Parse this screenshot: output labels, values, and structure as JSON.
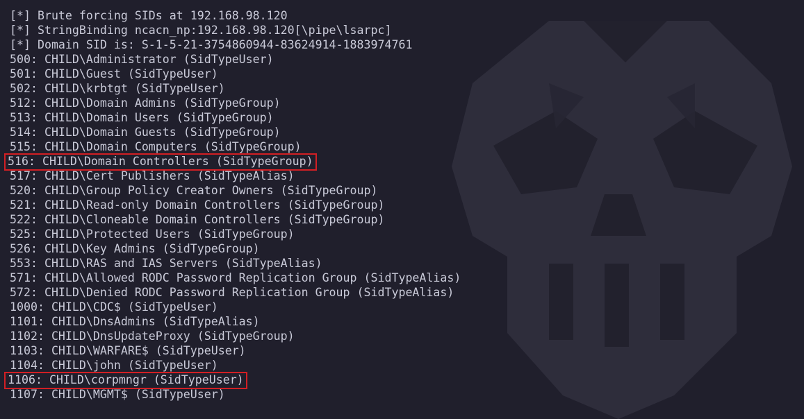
{
  "terminal": {
    "lines": [
      {
        "text": "[*] Brute forcing SIDs at 192.168.98.120",
        "highlighted": false
      },
      {
        "text": "[*] StringBinding ncacn_np:192.168.98.120[\\pipe\\lsarpc]",
        "highlighted": false
      },
      {
        "text": "[*] Domain SID is: S-1-5-21-3754860944-83624914-1883974761",
        "highlighted": false
      },
      {
        "text": "500: CHILD\\Administrator (SidTypeUser)",
        "highlighted": false
      },
      {
        "text": "501: CHILD\\Guest (SidTypeUser)",
        "highlighted": false
      },
      {
        "text": "502: CHILD\\krbtgt (SidTypeUser)",
        "highlighted": false
      },
      {
        "text": "512: CHILD\\Domain Admins (SidTypeGroup)",
        "highlighted": false
      },
      {
        "text": "513: CHILD\\Domain Users (SidTypeGroup)",
        "highlighted": false
      },
      {
        "text": "514: CHILD\\Domain Guests (SidTypeGroup)",
        "highlighted": false
      },
      {
        "text": "515: CHILD\\Domain Computers (SidTypeGroup)",
        "highlighted": false
      },
      {
        "text": "516: CHILD\\Domain Controllers (SidTypeGroup)",
        "highlighted": true
      },
      {
        "text": "517: CHILD\\Cert Publishers (SidTypeAlias)",
        "highlighted": false
      },
      {
        "text": "520: CHILD\\Group Policy Creator Owners (SidTypeGroup)",
        "highlighted": false
      },
      {
        "text": "521: CHILD\\Read-only Domain Controllers (SidTypeGroup)",
        "highlighted": false
      },
      {
        "text": "522: CHILD\\Cloneable Domain Controllers (SidTypeGroup)",
        "highlighted": false
      },
      {
        "text": "525: CHILD\\Protected Users (SidTypeGroup)",
        "highlighted": false
      },
      {
        "text": "526: CHILD\\Key Admins (SidTypeGroup)",
        "highlighted": false
      },
      {
        "text": "553: CHILD\\RAS and IAS Servers (SidTypeAlias)",
        "highlighted": false
      },
      {
        "text": "571: CHILD\\Allowed RODC Password Replication Group (SidTypeAlias)",
        "highlighted": false
      },
      {
        "text": "572: CHILD\\Denied RODC Password Replication Group (SidTypeAlias)",
        "highlighted": false
      },
      {
        "text": "1000: CHILD\\CDC$ (SidTypeUser)",
        "highlighted": false
      },
      {
        "text": "1101: CHILD\\DnsAdmins (SidTypeAlias)",
        "highlighted": false
      },
      {
        "text": "1102: CHILD\\DnsUpdateProxy (SidTypeGroup)",
        "highlighted": false
      },
      {
        "text": "1103: CHILD\\WARFARE$ (SidTypeUser)",
        "highlighted": false
      },
      {
        "text": "1104: CHILD\\john (SidTypeUser)",
        "highlighted": false
      },
      {
        "text": "1106: CHILD\\corpmngr (SidTypeUser)",
        "highlighted": true
      },
      {
        "text": "1107: CHILD\\MGMT$ (SidTypeUser)",
        "highlighted": false
      }
    ]
  },
  "colors": {
    "background": "#201f2c",
    "text": "#c9cad8",
    "highlight_box": "#d21f24",
    "logo": "#3a3948"
  },
  "background_logo": {
    "icon": "skull-logo-icon"
  }
}
